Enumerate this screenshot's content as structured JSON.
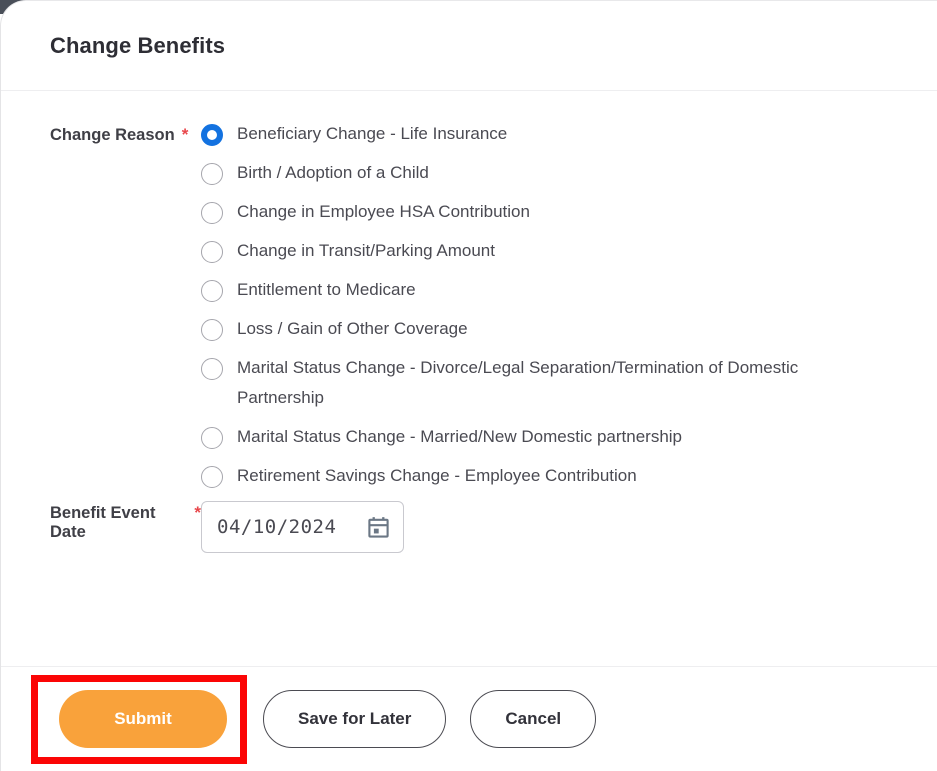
{
  "modal": {
    "title": "Change Benefits"
  },
  "form": {
    "change_reason": {
      "label": "Change Reason",
      "required_marker": "*",
      "selected_index": 0,
      "options": [
        "Beneficiary Change - Life Insurance",
        "Birth / Adoption of a Child",
        "Change in Employee HSA Contribution",
        "Change in Transit/Parking Amount",
        "Entitlement to Medicare",
        "Loss / Gain of Other Coverage",
        "Marital Status Change - Divorce/Legal Separation/Termination of Domestic Partnership",
        "Marital Status Change - Married/New Domestic partnership",
        "Retirement Savings Change - Employee Contribution"
      ]
    },
    "benefit_event_date": {
      "label": "Benefit Event Date",
      "required_marker": "*",
      "value": "04/10/2024",
      "icon": "calendar-icon"
    }
  },
  "footer": {
    "submit_label": "Submit",
    "save_for_later_label": "Save for Later",
    "cancel_label": "Cancel"
  },
  "colors": {
    "primary_button": "#f9a23b",
    "highlight_border": "#fb0505",
    "radio_selected": "#1372e0",
    "required_star": "#e8464a",
    "calendar_icon": "#6b7785"
  }
}
